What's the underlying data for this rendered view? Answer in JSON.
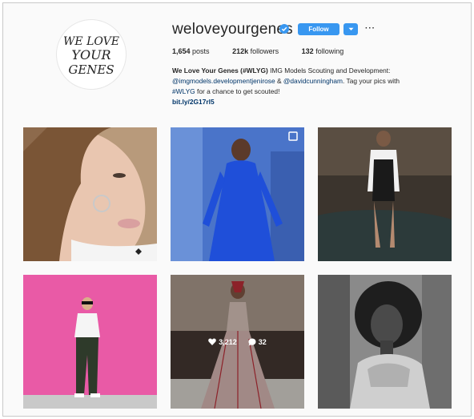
{
  "profile": {
    "avatar_text": [
      "WE LOVE",
      "YOUR",
      "GENES"
    ],
    "username": "weloveyourgenes",
    "follow_label": "Follow",
    "more_label": "···"
  },
  "stats": {
    "posts_count": "1,654",
    "posts_label": "posts",
    "followers_count": "212k",
    "followers_label": "followers",
    "following_count": "132",
    "following_label": "following"
  },
  "bio": {
    "name": "We Love Your Genes (#WLYG)",
    "line1_rest": "IMG Models Scouting and Development:",
    "mention1": "@imgmodels.development",
    "mention2": "jenirose",
    "amp": "&",
    "mention3": "@davidcunningham",
    "tag_text": ". Tag your pics with",
    "hashtag": "#WLYG",
    "line3_rest": "for a chance to get scouted!",
    "url": "bit.ly/2G17rl5"
  },
  "posts": [
    {
      "id": "post-1",
      "likes": "",
      "comments": ""
    },
    {
      "id": "post-2",
      "likes": "",
      "comments": ""
    },
    {
      "id": "post-3",
      "likes": "",
      "comments": ""
    },
    {
      "id": "post-4",
      "likes": "",
      "comments": ""
    },
    {
      "id": "post-5",
      "likes": "3,212",
      "comments": "32"
    },
    {
      "id": "post-6",
      "likes": "",
      "comments": ""
    }
  ],
  "colors": {
    "accent": "#3897f0",
    "link": "#003569",
    "background": "#fafafa"
  }
}
